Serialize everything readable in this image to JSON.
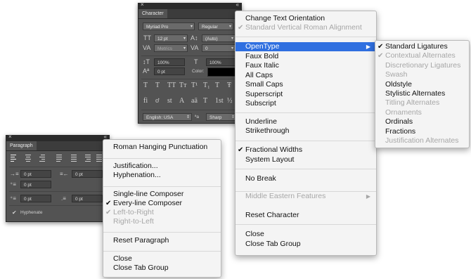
{
  "character_panel": {
    "close_glyph": "×",
    "collapse_glyph": "«",
    "tab": "Character",
    "menu_glyph": "≡",
    "font_family": "Myriad Pro",
    "font_style": "Regular",
    "font_size": "12 pt",
    "leading": "(Auto)",
    "kerning": "Metrics",
    "tracking": "0",
    "vertical_scale": "100%",
    "horizontal_scale": "100%",
    "baseline_shift": "0 pt",
    "color_label": "Color:",
    "style_buttons": [
      "T",
      "T",
      "TT",
      "Tт",
      "T¹",
      "T₁",
      "T",
      "Ŧ"
    ],
    "opentype_buttons": [
      "fi",
      "ơ",
      "st",
      "A",
      "aā",
      "T",
      "1st",
      "½"
    ],
    "language": "English: USA",
    "aa_glyph": "ªa",
    "antialias": "Sharp",
    "icons": {
      "size": "TT",
      "leading": "A↕",
      "kerning": "VA",
      "tracking": "VA",
      "vscale": "↕T",
      "hscale": "T",
      "baseline": "Aª"
    }
  },
  "paragraph_panel": {
    "close_glyph": "×",
    "collapse_glyph": "«",
    "tab": "Paragraph",
    "menu_glyph": "≡",
    "indent_left": "0 pt",
    "indent_right": "0 pt",
    "indent_first": "0 pt",
    "space_before": "0 pt",
    "space_after": "0 pt",
    "hyphenate_label": "Hyphenate",
    "hyphenate_checked": true,
    "check_glyph": "✔"
  },
  "paragraph_menu": {
    "items": [
      {
        "label": "Roman Hanging Punctuation",
        "check": ""
      },
      {
        "label": "Justification...",
        "check": ""
      },
      {
        "label": "Hyphenation...",
        "check": ""
      },
      {
        "label": "Single-line Composer",
        "check": ""
      },
      {
        "label": "Every-line Composer",
        "check": "✔"
      },
      {
        "label": "Left-to-Right",
        "check": "✔"
      },
      {
        "label": "Right-to-Left",
        "check": ""
      },
      {
        "label": "Reset Paragraph",
        "check": ""
      },
      {
        "label": "Close",
        "check": ""
      },
      {
        "label": "Close Tab Group",
        "check": ""
      }
    ]
  },
  "character_menu": {
    "items": [
      {
        "label": "Change Text Orientation",
        "check": ""
      },
      {
        "label": "Standard Vertical Roman Alignment",
        "check": "✔"
      },
      {
        "label": "OpenType",
        "check": "",
        "arrow": "▶"
      },
      {
        "label": "Faux Bold",
        "check": ""
      },
      {
        "label": "Faux Italic",
        "check": ""
      },
      {
        "label": "All Caps",
        "check": ""
      },
      {
        "label": "Small Caps",
        "check": ""
      },
      {
        "label": "Superscript",
        "check": ""
      },
      {
        "label": "Subscript",
        "check": ""
      },
      {
        "label": "Underline",
        "check": ""
      },
      {
        "label": "Strikethrough",
        "check": ""
      },
      {
        "label": "Fractional Widths",
        "check": "✔"
      },
      {
        "label": "System Layout",
        "check": ""
      },
      {
        "label": "No Break",
        "check": ""
      },
      {
        "label": "Middle Eastern Features",
        "check": "",
        "arrow": "▶"
      },
      {
        "label": "Reset Character",
        "check": ""
      },
      {
        "label": "Close",
        "check": ""
      },
      {
        "label": "Close Tab Group",
        "check": ""
      }
    ]
  },
  "opentype_menu": {
    "items": [
      {
        "label": "Standard Ligatures",
        "check": "✔"
      },
      {
        "label": "Contextual Alternates",
        "check": "✔"
      },
      {
        "label": "Discretionary Ligatures",
        "check": ""
      },
      {
        "label": "Swash",
        "check": ""
      },
      {
        "label": "Oldstyle",
        "check": ""
      },
      {
        "label": "Stylistic Alternates",
        "check": ""
      },
      {
        "label": "Titling Alternates",
        "check": ""
      },
      {
        "label": "Ornaments",
        "check": ""
      },
      {
        "label": "Ordinals",
        "check": ""
      },
      {
        "label": "Fractions",
        "check": ""
      },
      {
        "label": "Justification Alternates",
        "check": ""
      }
    ]
  },
  "colors": {
    "highlight": "#2f6fe0",
    "panel": "#535353",
    "menu_bg": "#f4f4f4",
    "disabled_text": "#a7a7a7"
  }
}
